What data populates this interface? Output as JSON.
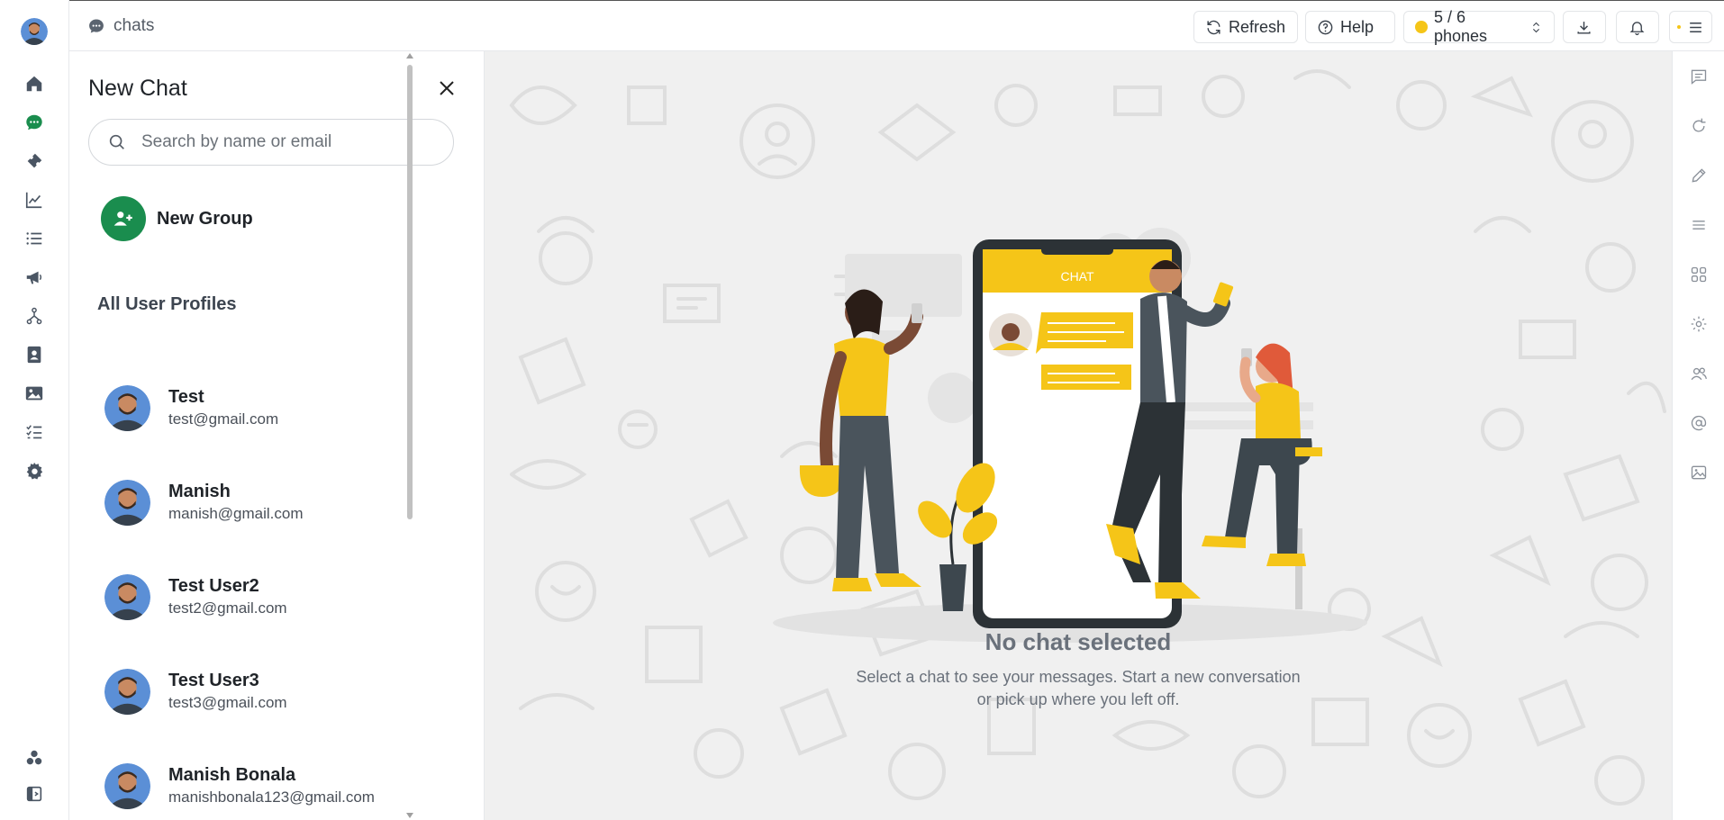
{
  "topbar": {
    "section_label": "chats",
    "refresh_label": "Refresh",
    "help_label": "Help",
    "phones_label": "5 / 6 phones",
    "status_color": "#f5c518"
  },
  "rail": {
    "items": [
      {
        "icon": "avatar"
      },
      {
        "icon": "home-icon"
      },
      {
        "icon": "chat-icon",
        "active": true,
        "color": "#1a8d4e"
      },
      {
        "icon": "ticket-icon"
      },
      {
        "icon": "chart-line-icon"
      },
      {
        "icon": "list-icon"
      },
      {
        "icon": "megaphone-icon"
      },
      {
        "icon": "flow-icon"
      },
      {
        "icon": "contacts-icon"
      },
      {
        "icon": "image-icon"
      },
      {
        "icon": "checklist-icon"
      },
      {
        "icon": "gear-icon"
      },
      {
        "icon": "apps-icon"
      },
      {
        "icon": "collapse-sidebar-icon"
      }
    ]
  },
  "panel": {
    "title": "New Chat",
    "search_placeholder": "Search by name or email",
    "new_group_label": "New Group",
    "section_title": "All User Profiles",
    "users": [
      {
        "name": "Test",
        "email": "test@gmail.com"
      },
      {
        "name": "Manish",
        "email": "manish@gmail.com"
      },
      {
        "name": "Test User2",
        "email": "test2@gmail.com"
      },
      {
        "name": "Test User3",
        "email": "test3@gmail.com"
      },
      {
        "name": "Manish Bonala",
        "email": "manishbonala123@gmail.com"
      }
    ]
  },
  "main": {
    "illustration_label": "CHAT",
    "empty_title": "No chat selected",
    "empty_desc_line1": "Select a chat to see your messages. Start a new conversation",
    "empty_desc_line2": "or pick up where you left off."
  },
  "right_rail": {
    "icons": [
      "message-square-icon",
      "refresh-icon",
      "pencil-icon",
      "lines-icon",
      "grid-icon",
      "settings-icon",
      "users-icon",
      "at-sign-icon",
      "image-icon"
    ]
  },
  "colors": {
    "brand_green": "#1a8d4e",
    "accent_yellow": "#f5c518",
    "text_muted": "#6a717b"
  }
}
